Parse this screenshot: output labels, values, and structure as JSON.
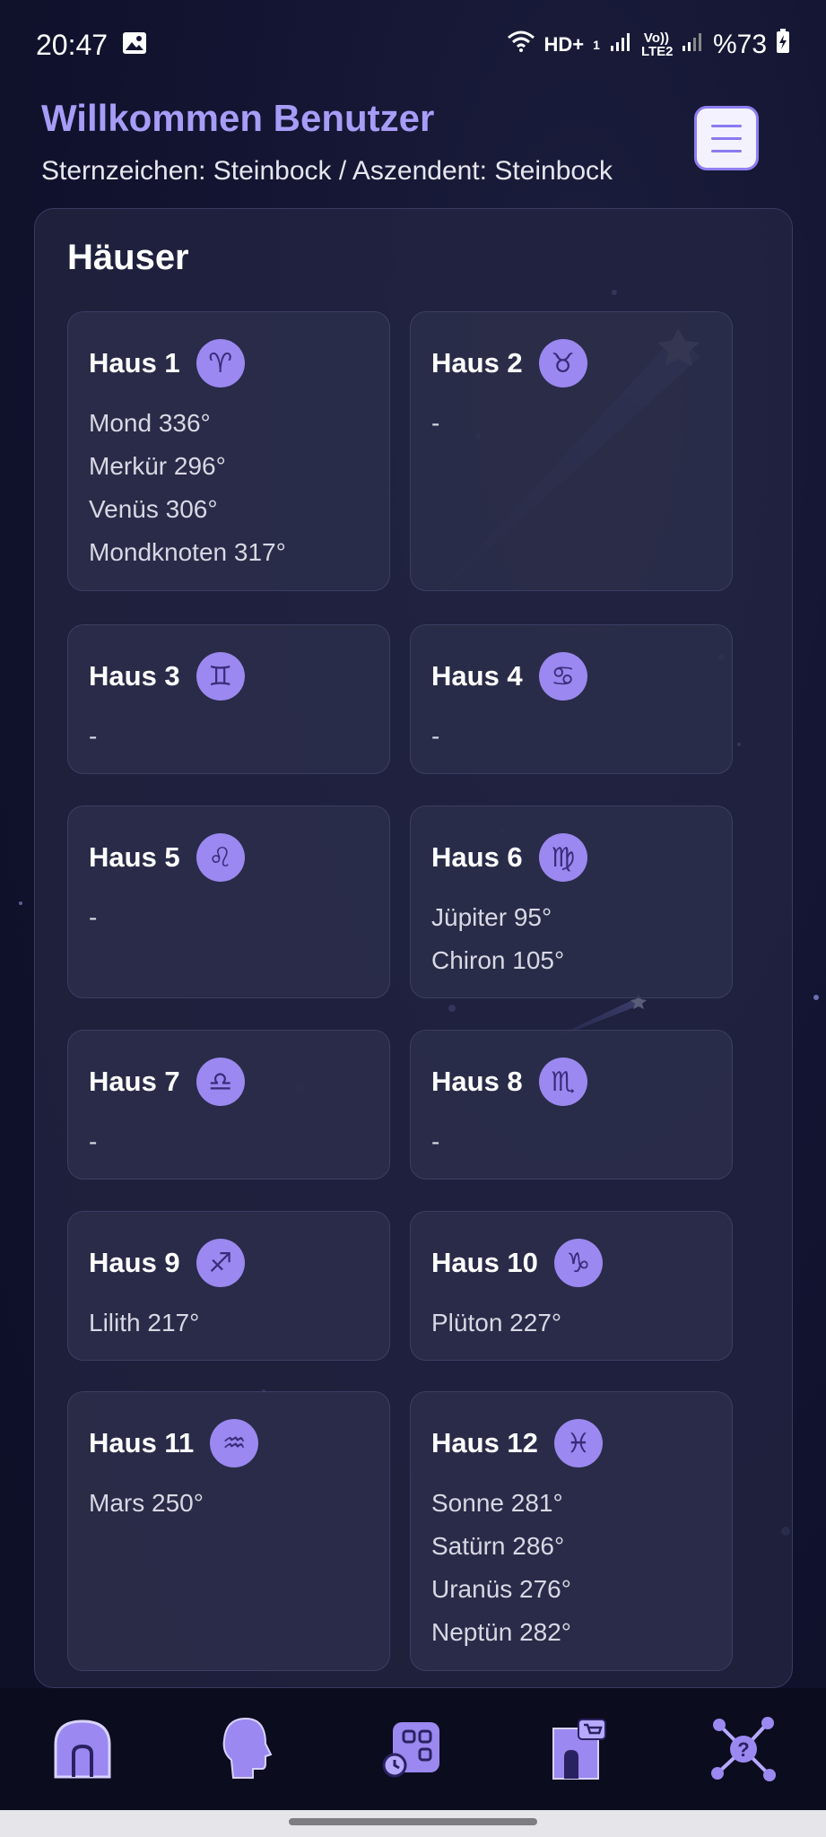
{
  "status_bar": {
    "time": "20:47",
    "hd_label": "HD+",
    "sim_label": "1",
    "volte_label": "Vo)) LTE2",
    "battery": "%73"
  },
  "header": {
    "welcome": "Willkommen Benutzer",
    "subline": "Sternzeichen: Steinbock / Aszendent: Steinbock"
  },
  "houses": {
    "title": "Häuser",
    "items": [
      {
        "title": "Haus 1",
        "sign_icon": "aries-icon",
        "glyph": "♈",
        "planets": [
          "Mond 336°",
          "Merkür 296°",
          "Venüs 306°",
          "Mondknoten 317°"
        ]
      },
      {
        "title": "Haus 2",
        "sign_icon": "taurus-icon",
        "glyph": "♉",
        "planets": [
          "-"
        ]
      },
      {
        "title": "Haus 3",
        "sign_icon": "gemini-icon",
        "glyph": "♊",
        "planets": [
          "-"
        ]
      },
      {
        "title": "Haus 4",
        "sign_icon": "cancer-icon",
        "glyph": "♋",
        "planets": [
          "-"
        ]
      },
      {
        "title": "Haus 5",
        "sign_icon": "leo-icon",
        "glyph": "♌",
        "planets": [
          "-"
        ]
      },
      {
        "title": "Haus 6",
        "sign_icon": "virgo-icon",
        "glyph": "♍",
        "planets": [
          "Jüpiter 95°",
          "Chiron 105°"
        ]
      },
      {
        "title": "Haus 7",
        "sign_icon": "libra-icon",
        "glyph": "♎",
        "planets": [
          "-"
        ]
      },
      {
        "title": "Haus 8",
        "sign_icon": "scorpio-icon",
        "glyph": "♏",
        "planets": [
          "-"
        ]
      },
      {
        "title": "Haus 9",
        "sign_icon": "sagittarius-icon",
        "glyph": "♐",
        "planets": [
          "Lilith 217°"
        ]
      },
      {
        "title": "Haus 10",
        "sign_icon": "capricorn-icon",
        "glyph": "♑",
        "planets": [
          "Plüton 227°"
        ]
      },
      {
        "title": "Haus 11",
        "sign_icon": "aquarius-icon",
        "glyph": "♒",
        "planets": [
          "Mars 250°"
        ]
      },
      {
        "title": "Haus 12",
        "sign_icon": "pisces-icon",
        "glyph": "♓",
        "planets": [
          "Sonne 281°",
          "Satürn 286°",
          "Uranüs 276°",
          "Neptün 282°"
        ]
      }
    ]
  },
  "bottom_nav": {
    "items": [
      {
        "icon": "home-icon"
      },
      {
        "icon": "head-profile-icon"
      },
      {
        "icon": "apps-grid-icon"
      },
      {
        "icon": "shop-icon"
      },
      {
        "icon": "network-help-icon"
      }
    ]
  },
  "colors": {
    "accent": "#9b88f0",
    "welcome": "#a79cf6",
    "background": "#121431",
    "card": "#2c2e4a"
  }
}
